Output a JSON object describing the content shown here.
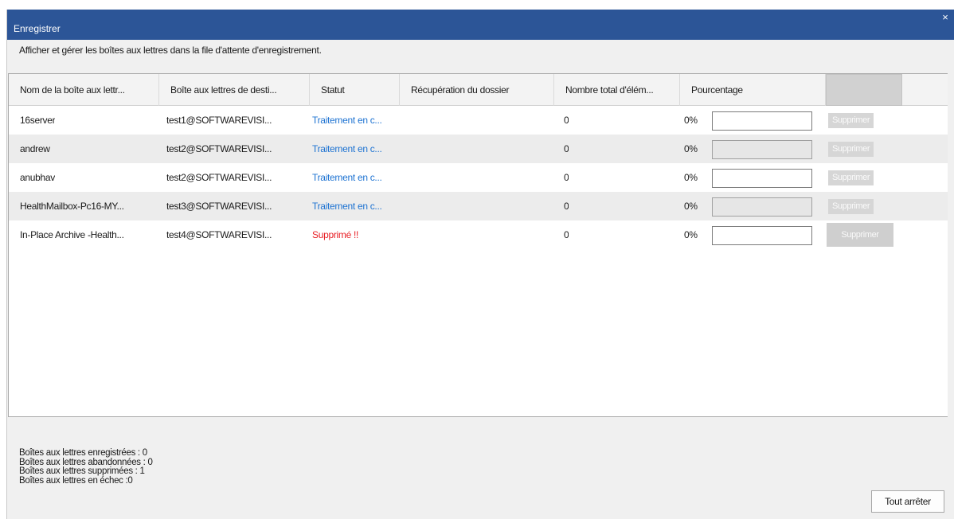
{
  "window": {
    "title": "Enregistrer",
    "close_glyph": "×",
    "titlebar_color": "#2c5597"
  },
  "intro_text": "Afficher et gérer les boîtes aux lettres dans la file d'attente d'enregistrement.",
  "table": {
    "columns": [
      "Nom de la boîte aux lettr...",
      "Boîte aux lettres de desti...",
      "Statut",
      "Récupération du dossier",
      "Nombre total d'élém...",
      "Pourcentage",
      ""
    ],
    "rows": [
      {
        "name": "16server",
        "destination": "test1@SOFTWAREVISI...",
        "status": "Traitement en c...",
        "status_kind": "processing",
        "folder": "",
        "total": "0",
        "percent_text": "0%",
        "percent": 0,
        "delete_label": "Supprimer"
      },
      {
        "name": "andrew",
        "destination": "test2@SOFTWAREVISI...",
        "status": "Traitement en c...",
        "status_kind": "processing",
        "folder": "",
        "total": "0",
        "percent_text": "0%",
        "percent": 0,
        "delete_label": "Supprimer"
      },
      {
        "name": "anubhav",
        "destination": "test2@SOFTWAREVISI...",
        "status": "Traitement en c...",
        "status_kind": "processing",
        "folder": "",
        "total": "0",
        "percent_text": "0%",
        "percent": 0,
        "delete_label": "Supprimer"
      },
      {
        "name": "HealthMailbox-Pc16-MY...",
        "destination": "test3@SOFTWAREVISI...",
        "status": "Traitement en c...",
        "status_kind": "processing",
        "folder": "",
        "total": "0",
        "percent_text": "0%",
        "percent": 0,
        "delete_label": "Supprimer"
      },
      {
        "name": "In-Place Archive -Health...",
        "destination": "test4@SOFTWAREVISI...",
        "status": "Supprimé !!",
        "status_kind": "deleted",
        "folder": "",
        "total": "0",
        "percent_text": "0%",
        "percent": 0,
        "delete_label": "Supprimer"
      }
    ]
  },
  "summary": {
    "saved": "Boîtes aux lettres enregistrées : 0",
    "abandoned": "Boîtes aux lettres abandonnées : 0",
    "deleted": "Boîtes aux lettres supprimées :  1",
    "failed": "Boîtes aux lettres en échec  :0"
  },
  "stop_all_label": "Tout arrêter",
  "colors": {
    "status_processing": "#1e73d2",
    "status_deleted": "#e81e24"
  }
}
